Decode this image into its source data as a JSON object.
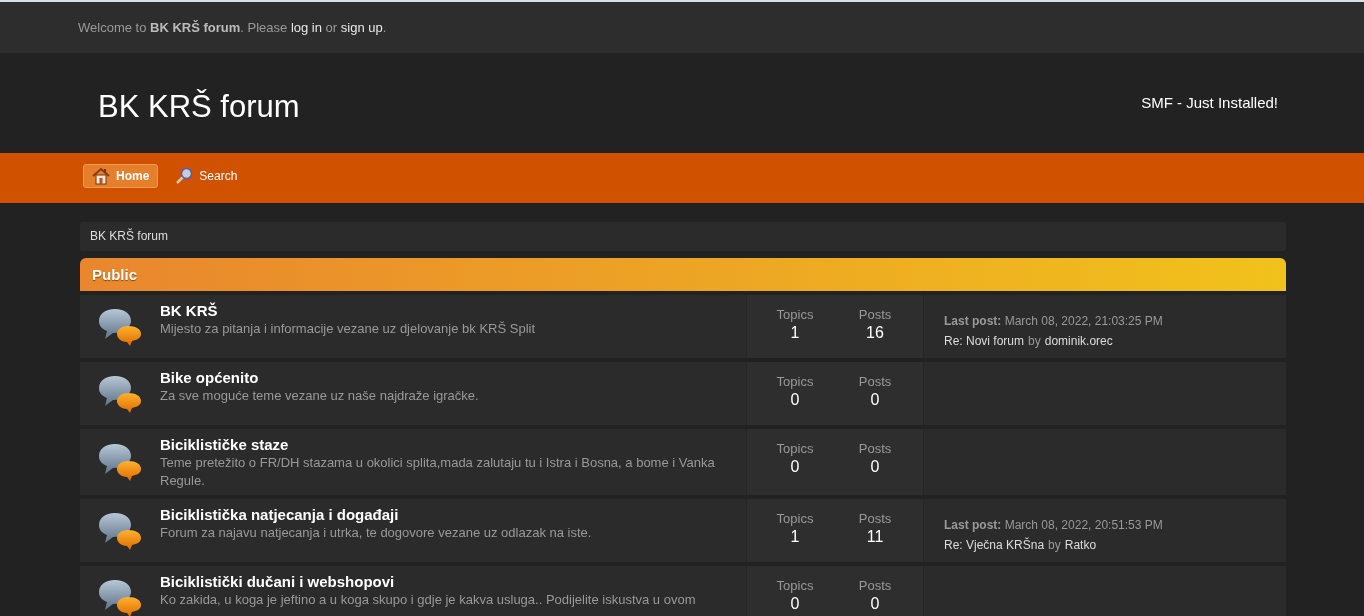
{
  "welcome": [
    {
      "kind": "plain",
      "text": "Welcome to "
    },
    {
      "kind": "bold",
      "text": "BK KRŠ forum"
    },
    {
      "kind": "plain",
      "text": ". Please "
    },
    {
      "kind": "link",
      "text": "log in"
    },
    {
      "kind": "plain",
      "text": " or "
    },
    {
      "kind": "link",
      "text": "sign up"
    },
    {
      "kind": "plain",
      "text": "."
    }
  ],
  "header": {
    "title": "BK KRŠ forum",
    "slogan": "SMF - Just Installed!"
  },
  "nav": [
    {
      "label": "Home",
      "kind": "home",
      "selected": true
    },
    {
      "label": "Search",
      "kind": "search",
      "selected": false
    }
  ],
  "breadcrumb": "BK KRŠ forum",
  "category": {
    "title": "Public",
    "boards": [
      {
        "name": "BK KRŠ",
        "description": "Mijesto za pitanja i informacije vezane uz djelovanje bk KRŠ Split",
        "topics_label": "Topics",
        "topics": "1",
        "posts_label": "Posts",
        "posts": "16",
        "last_post": {
          "info": "**Last post:** March 08, 2022, 21:03:25 PM",
          "topic": "Re: Novi forum",
          "by": "by",
          "author": "dominik.orec"
        }
      },
      {
        "name": "Bike općenito",
        "description": "Za sve moguće teme vezane uz naše najdraže igračke.",
        "topics_label": "Topics",
        "topics": "0",
        "posts_label": "Posts",
        "posts": "0"
      },
      {
        "name": "Biciklističke staze",
        "description": "Teme pretežito o FR/DH stazama u okolici splita,mada zalutaju tu i Istra i Bosna, a bome i Vanka Regule.",
        "topics_label": "Topics",
        "topics": "0",
        "posts_label": "Posts",
        "posts": "0"
      },
      {
        "name": "Biciklistička natjecanja i događaji",
        "description": "Forum za najavu natjecanja i utrka, te dogovore vezane uz odlazak na iste.",
        "topics_label": "Topics",
        "topics": "1",
        "posts_label": "Posts",
        "posts": "11",
        "last_post": {
          "info": "**Last post:** March 08, 2022, 20:51:53 PM",
          "topic": "Re: Vječna KRŠna",
          "by": "by",
          "author": "Ratko"
        }
      },
      {
        "name": "Biciklistički dučani i webshopovi",
        "description": "Ko zakida, u koga je jeftino a u koga skupo i gdje je kakva usluga.. Podijelite iskustva u ovom",
        "topics_label": "Topics",
        "topics": "0",
        "posts_label": "Posts",
        "posts": "0"
      }
    ]
  }
}
